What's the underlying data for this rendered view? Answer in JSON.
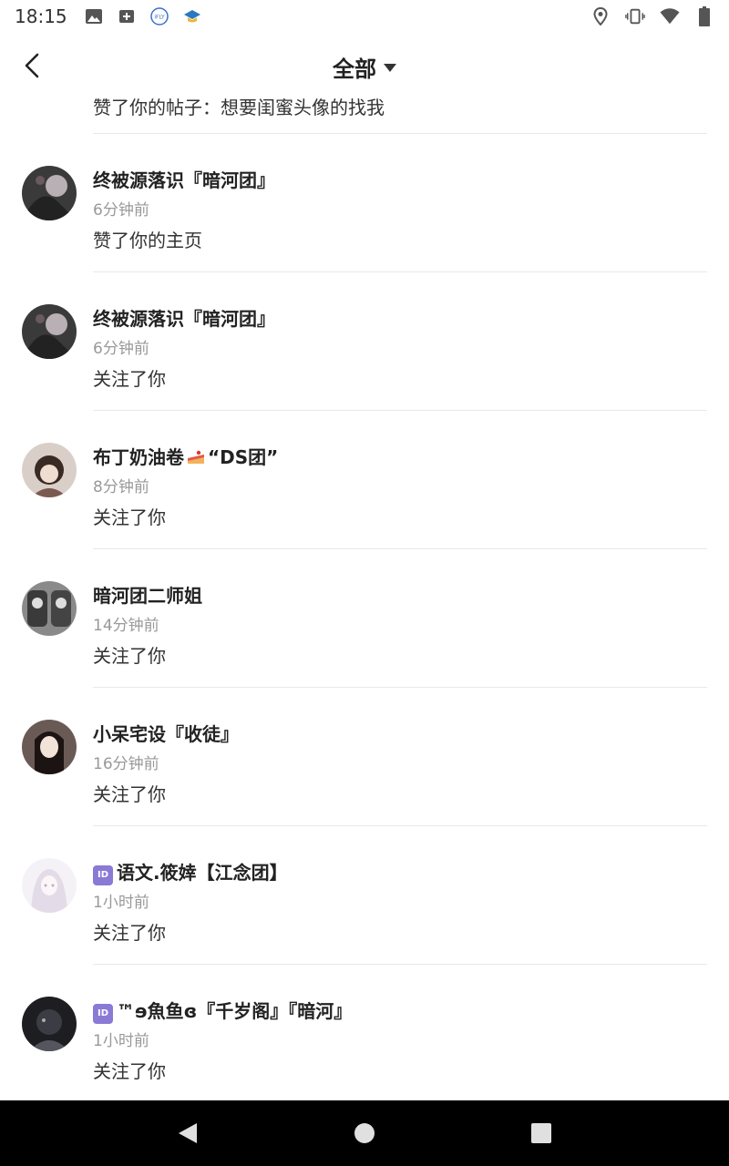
{
  "status_bar": {
    "time": "18:15",
    "left_icons": [
      "image-icon",
      "plus-box-icon",
      "ifly-icon",
      "edu-cap-icon"
    ],
    "right_icons": [
      "location-icon",
      "vibrate-icon",
      "wifi-icon",
      "battery-icon"
    ]
  },
  "header": {
    "back_icon": "back-arrow-icon",
    "title": "全部",
    "caret_icon": "caret-down-icon"
  },
  "partial_item": {
    "action": "赞了你的帖子：想要闺蜜头像的找我"
  },
  "notifications": [
    {
      "name": "终被源落识『暗河团』",
      "time": "6分钟前",
      "action": "赞了你的主页",
      "avatar_color": "#3a3a3a"
    },
    {
      "name": "终被源落识『暗河团』",
      "time": "6分钟前",
      "action": "关注了你",
      "avatar_color": "#3a3a3a"
    },
    {
      "name_prefix": "布丁奶油卷",
      "name_suffix": "“DS团”",
      "time": "8分钟前",
      "action": "关注了你",
      "avatar_color": "#5a4036"
    },
    {
      "name": "暗河团二师姐",
      "time": "14分钟前",
      "action": "关注了你",
      "avatar_color": "#555555"
    },
    {
      "name": "小呆宅设『收徒』",
      "time": "16分钟前",
      "action": "关注了你",
      "avatar_color": "#2b2220"
    },
    {
      "badge": "ID",
      "name": "语文.筱婞【江念团】",
      "time": "1小时前",
      "action": "关注了你",
      "avatar_color": "#e6e2ea"
    },
    {
      "badge": "ID",
      "name": "™ɘ魚鱼ɞ『千岁阁』『暗河』",
      "time": "1小时前",
      "action": "关注了你",
      "avatar_color": "#1e1e22"
    }
  ],
  "nav_bar": {
    "buttons": [
      "back-triangle-icon",
      "home-circle-icon",
      "recents-square-icon"
    ]
  }
}
